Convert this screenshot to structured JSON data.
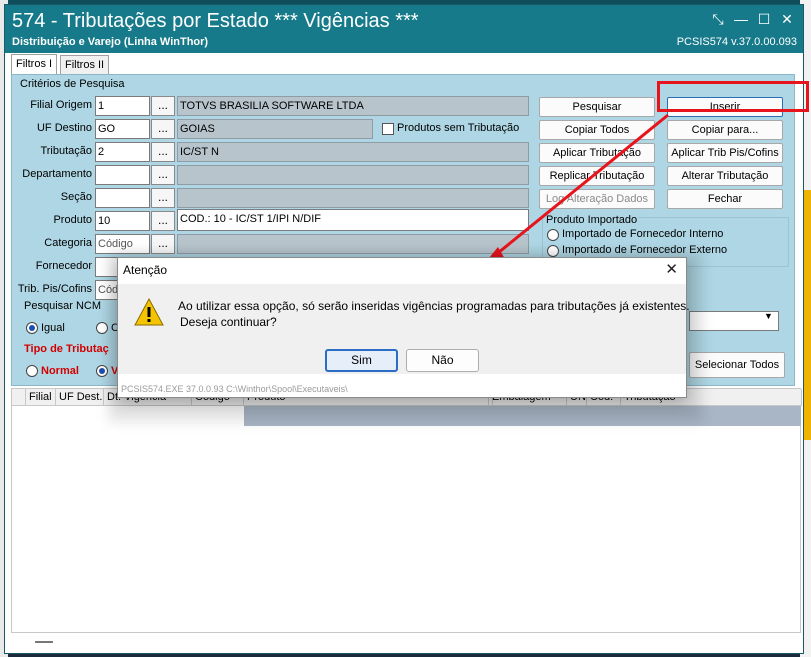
{
  "window": {
    "title": "574 - Tributações por Estado *** Vigências ***",
    "subtitle": "Distribuição e Varejo (Linha WinThor)",
    "version": "PCSIS574  v.37.0.00.093",
    "accent_color": "#167a8a"
  },
  "tabs": [
    {
      "label": "Filtros I"
    },
    {
      "label": "Filtros II"
    }
  ],
  "criteria": {
    "group_title": "Critérios de Pesquisa",
    "labels": {
      "filial_origem": "Filial Origem",
      "uf_destino": "UF Destino",
      "tributacao": "Tributação",
      "departamento": "Departamento",
      "secao": "Seção",
      "produto": "Produto",
      "categoria": "Categoria",
      "fornecedor": "Fornecedor",
      "trib_pis": "Trib. Pis/Cofins"
    },
    "filial_origem": {
      "code": "1",
      "desc": "TOTVS BRASILIA SOFTWARE LTDA"
    },
    "uf_destino": {
      "code": "GO",
      "desc": "GOIAS"
    },
    "produtos_sem_tributacao": "Produtos sem Tributação",
    "tributacao": {
      "code": "2",
      "desc": "IC/ST N"
    },
    "produto": {
      "code": "10",
      "desc": "COD.: 10 - IC/ST 1/IPI N/DIF"
    },
    "categoria_placeholder": "Código",
    "trib_pis_placeholder": "Códi",
    "dots_label": "..."
  },
  "buttons": {
    "pesquisar": "Pesquisar",
    "inserir": "Inserir",
    "copiar_todos": "Copiar Todos",
    "copiar_para": "Copiar para...",
    "aplicar_tributacao": "Aplicar Tributação",
    "aplicar_trib_pis": "Aplicar Trib Pis/Cofins",
    "replicar_tributacao": "Replicar Tributação",
    "alterar_tributacao": "Alterar Tributação",
    "log_alteracao": "Log Alteração Dados",
    "fechar": "Fechar",
    "selecionar_todos": "Selecionar Todos"
  },
  "produto_importado": {
    "title": "Produto Importado",
    "options": [
      "Importado de Fornecedor Interno",
      "Importado de Fornecedor Externo"
    ]
  },
  "ncm": {
    "title": "Pesquisar NCM",
    "option_igual": "Igual",
    "option_2_partial": "Co"
  },
  "tipo_tributacao": {
    "title": "Tipo de Tributaç",
    "option_normal": "Normal",
    "option_2_partial": "V"
  },
  "grid": {
    "columns": [
      "",
      "Filial",
      "UF Dest.",
      "Dt. Vigência",
      "Código",
      "Produto",
      "",
      "Embalagem",
      "UN",
      "Cód.",
      "Tributação"
    ]
  },
  "dialog": {
    "title": "Atenção",
    "message_line1": "Ao utilizar essa opção, só serão inseridas vigências programadas para tributações já existentes.",
    "message_line2": "Deseja continuar?",
    "yes": "Sim",
    "no": "Não",
    "status": "PCSIS574.EXE 37.0.0.93 C:\\Winthor\\Spool\\Executaveis\\"
  },
  "annotation": {
    "highlight_color": "#e8141c"
  }
}
